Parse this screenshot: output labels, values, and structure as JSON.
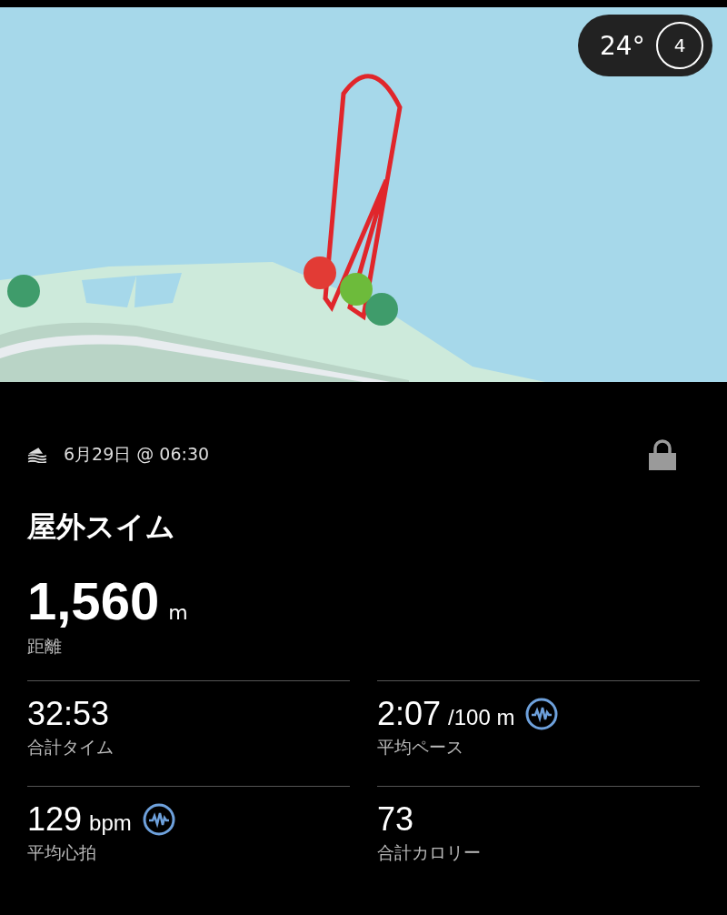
{
  "map": {
    "weather": {
      "temperature": "24°",
      "wind": "4"
    }
  },
  "activity": {
    "date": "6月29日 @ 06:30",
    "locked": true,
    "title": "屋外スイム"
  },
  "distance": {
    "value": "1,560",
    "unit": "m",
    "label": "距離"
  },
  "stats": [
    {
      "value": "32:53",
      "label": "合計タイム",
      "chart": false
    },
    {
      "value": "2:07",
      "unit": "/100 m",
      "label": "平均ペース",
      "chart": true
    },
    {
      "value": "129",
      "unit": "bpm",
      "label": "平均心拍",
      "chart": true
    },
    {
      "value": "73",
      "label": "合計カロリー",
      "chart": false
    }
  ]
}
